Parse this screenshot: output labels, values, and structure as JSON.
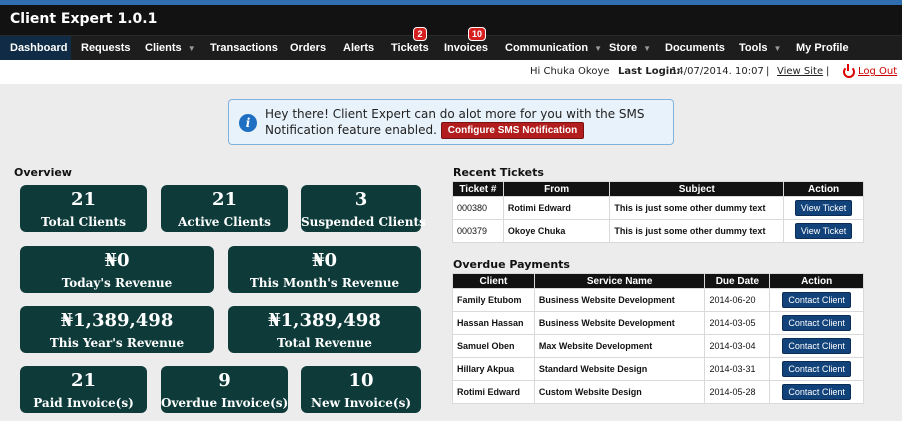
{
  "app": {
    "title": "Client Expert 1.0.1"
  },
  "nav": {
    "dashboard": "Dashboard",
    "requests": "Requests",
    "clients": "Clients",
    "transactions": "Transactions",
    "orders": "Orders",
    "alerts": "Alerts",
    "tickets": "Tickets",
    "tickets_badge": "2",
    "invoices": "Invoices",
    "invoices_badge": "10",
    "communication": "Communication",
    "store": "Store",
    "documents": "Documents",
    "tools": "Tools",
    "my_profile": "My Profile",
    "caret": "▼"
  },
  "userbar": {
    "greeting": "Hi Chuka Okoye",
    "last_login_label": "Last Login:",
    "last_login_value": "14/07/2014. 10:07",
    "sep": "|",
    "view_site": "View Site",
    "logout": "Log Out"
  },
  "notice": {
    "text": "Hey there! Client Expert can do alot more for you with the SMS Notification feature enabled.",
    "button": "Configure SMS Notification",
    "icon": "i"
  },
  "overview": {
    "title": "Overview",
    "total_clients": {
      "value": "21",
      "label": "Total Clients"
    },
    "active_clients": {
      "value": "21",
      "label": "Active Clients"
    },
    "suspended_clients": {
      "value": "3",
      "label": "Suspended Clients"
    },
    "today_revenue": {
      "value": "₦0",
      "label": "Today's Revenue"
    },
    "month_revenue": {
      "value": "₦0",
      "label": "This Month's Revenue"
    },
    "year_revenue": {
      "value": "₦1,389,498",
      "label": "This Year's Revenue"
    },
    "total_revenue": {
      "value": "₦1,389,498",
      "label": "Total Revenue"
    },
    "paid_invoices": {
      "value": "21",
      "label": "Paid Invoice(s)"
    },
    "overdue_invoices": {
      "value": "9",
      "label": "Overdue Invoice(s)"
    },
    "new_invoices": {
      "value": "10",
      "label": "New Invoice(s)"
    }
  },
  "tickets": {
    "title": "Recent Tickets",
    "headers": [
      "Ticket #",
      "From",
      "Subject",
      "Action"
    ],
    "rows": [
      {
        "id": "000380",
        "from": "Rotimi Edward",
        "subject": "This is just some other dummy text",
        "action": "View Ticket"
      },
      {
        "id": "000379",
        "from": "Okoye Chuka",
        "subject": "This is just some other dummy text",
        "action": "View Ticket"
      }
    ]
  },
  "overdue": {
    "title": "Overdue Payments",
    "headers": [
      "Client",
      "Service Name",
      "Due Date",
      "Action"
    ],
    "rows": [
      {
        "client": "Family Etubom",
        "service": "Business Website Development",
        "due": "2014-06-20",
        "action": "Contact Client"
      },
      {
        "client": "Hassan Hassan",
        "service": "Business Website Development",
        "due": "2014-03-05",
        "action": "Contact Client"
      },
      {
        "client": "Samuel Oben",
        "service": "Max Website Development",
        "due": "2014-03-04",
        "action": "Contact Client"
      },
      {
        "client": "Hillary Akpua",
        "service": "Standard Website Design",
        "due": "2014-03-31",
        "action": "Contact Client"
      },
      {
        "client": "Rotimi Edward",
        "service": "Custom Website Design",
        "due": "2014-05-28",
        "action": "Contact Client"
      }
    ]
  },
  "colors": {
    "tile": "#0e3b3a",
    "nav_active": "#0f2b45",
    "badge": "#d62020",
    "action_button": "#12427a",
    "sms_button": "#b21d1d"
  }
}
